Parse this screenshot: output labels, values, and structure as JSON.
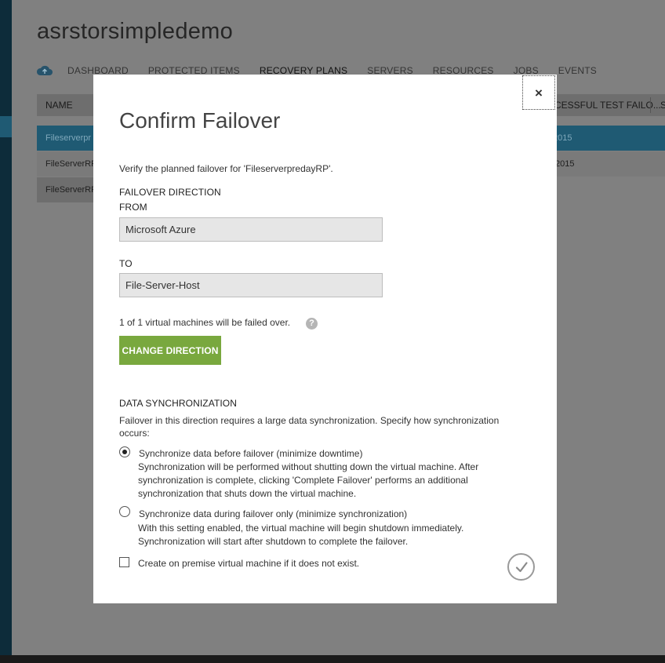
{
  "background": {
    "title": "asrstorsimpledemo",
    "nav": [
      {
        "label": "DASHBOARD"
      },
      {
        "label": "PROTECTED ITEMS"
      },
      {
        "label": "RECOVERY PLANS"
      },
      {
        "label": "SERVERS"
      },
      {
        "label": "RESOURCES"
      },
      {
        "label": "JOBS"
      },
      {
        "label": "EVENTS"
      }
    ],
    "table": {
      "headers": {
        "name": "NAME",
        "last_test": "CESSFUL TEST FAILO...",
        "more": "S"
      },
      "rows": [
        {
          "name": "Fileserverpr",
          "date": "2015"
        },
        {
          "name": "FileServerRF",
          "date": "/2015"
        },
        {
          "name": "FileServerRF",
          "date": ""
        }
      ]
    }
  },
  "modal": {
    "close_label": "×",
    "title": "Confirm Failover",
    "verify_text": "Verify the planned failover for 'FileserverpredayRP'.",
    "direction_label": "FAILOVER DIRECTION",
    "from_label": "FROM",
    "from_value": "Microsoft Azure",
    "to_label": "TO",
    "to_value": "File-Server-Host",
    "vm_count_text": "1 of 1 virtual machines will be failed over.",
    "help_icon": "?",
    "change_direction_label": "CHANGE DIRECTION",
    "sync_label": "DATA SYNCHRONIZATION",
    "sync_intro": "Failover in this direction requires a large data synchronization. Specify how synchronization occurs:",
    "options": [
      {
        "title": "Synchronize data before failover (minimize downtime)",
        "description": "Synchronization will be performed without shutting down the virtual machine. After synchronization is complete, clicking 'Complete Failover' performs an additional synchronization that shuts down the virtual machine.",
        "selected": true
      },
      {
        "title": "Synchronize data during failover only (minimize synchronization)",
        "description": "With this setting enabled, the virtual machine will begin shutdown immediately. Synchronization will start after shutdown to complete the failover.",
        "selected": false
      }
    ],
    "create_vm_label": "Create on premise virtual machine if it does not exist.",
    "create_vm_checked": false
  },
  "colors": {
    "accent_green": "#79a83e",
    "selected_row": "#1f5a73",
    "overlay_gray": "#808080"
  }
}
